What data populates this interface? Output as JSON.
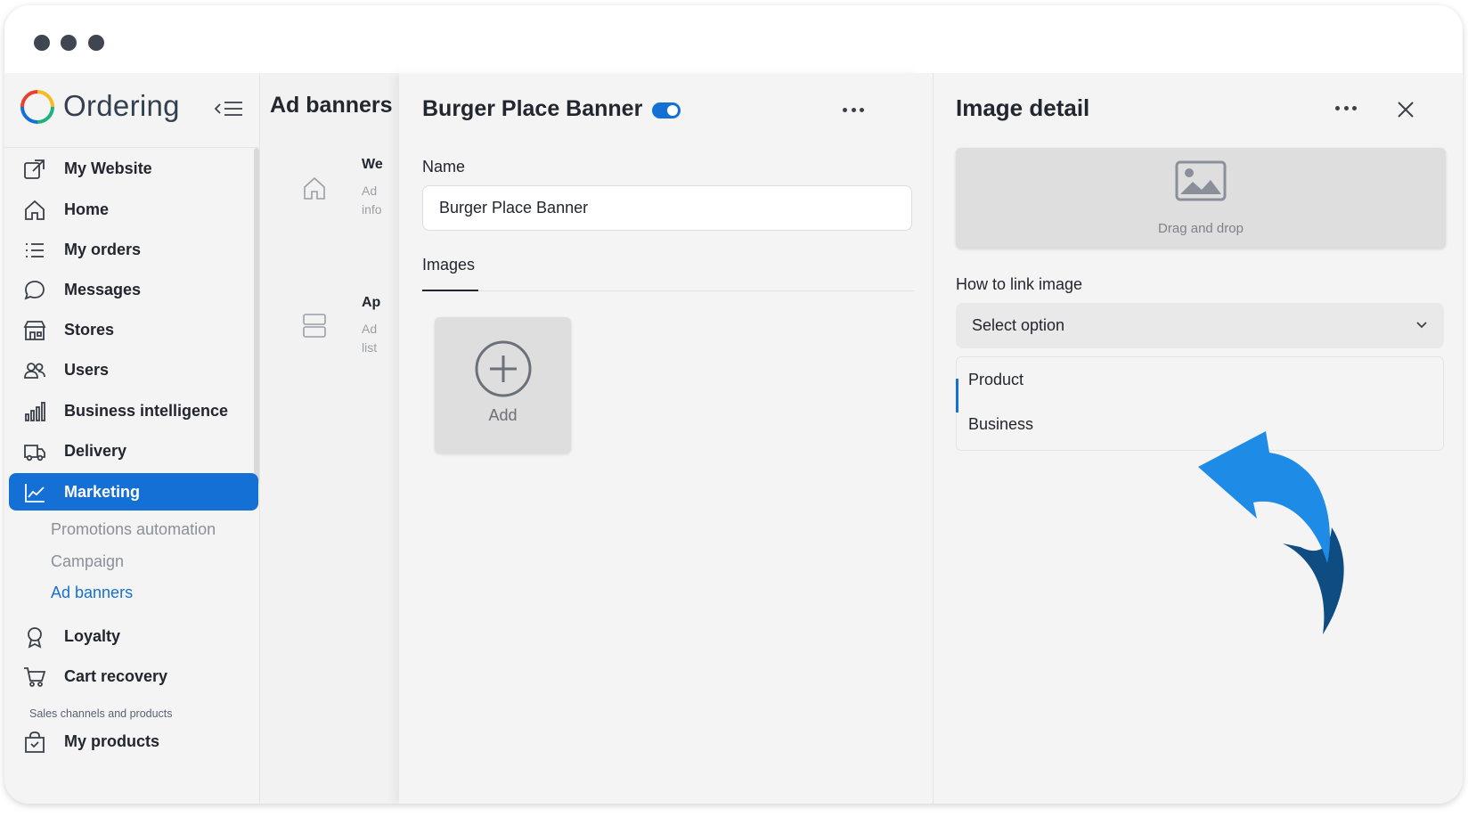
{
  "window": {
    "traffic_lights": [
      "close",
      "minimize",
      "maximize"
    ]
  },
  "brand": {
    "name": "Ordering",
    "accent_color": "#1570d6"
  },
  "sidebar": {
    "items": [
      {
        "label": "My Website",
        "icon": "external-link-icon"
      },
      {
        "label": "Home",
        "icon": "home-icon"
      },
      {
        "label": "My orders",
        "icon": "list-icon"
      },
      {
        "label": "Messages",
        "icon": "chat-bubble-icon"
      },
      {
        "label": "Stores",
        "icon": "store-icon"
      },
      {
        "label": "Users",
        "icon": "users-icon"
      },
      {
        "label": "Business intelligence",
        "icon": "bar-chart-icon"
      },
      {
        "label": "Delivery",
        "icon": "truck-icon"
      },
      {
        "label": "Marketing",
        "icon": "line-chart-icon",
        "active": true
      },
      {
        "label": "Loyalty",
        "icon": "award-icon"
      },
      {
        "label": "Cart recovery",
        "icon": "cart-icon"
      },
      {
        "label": "My products",
        "icon": "bag-icon"
      }
    ],
    "marketing_sub": [
      "Promotions automation",
      "Campaign",
      "Ad banners"
    ],
    "section_label": "Sales channels and products"
  },
  "ad_banners_page": {
    "title": "Ad banners",
    "rows": [
      {
        "title": "We",
        "desc_1": "Ad",
        "desc_2": "info"
      },
      {
        "title": "Ap",
        "desc_1": "Ad",
        "desc_2": "list"
      }
    ]
  },
  "banner": {
    "title": "Burger Place Banner",
    "enabled": true,
    "name_label": "Name",
    "name_value": "Burger Place Banner",
    "tab_images": "Images",
    "add_label": "Add"
  },
  "image_detail": {
    "title": "Image detail",
    "drop_label": "Drag and drop",
    "link_label": "How to link image",
    "select_value": "Select option",
    "options": [
      "Product",
      "Business"
    ]
  }
}
